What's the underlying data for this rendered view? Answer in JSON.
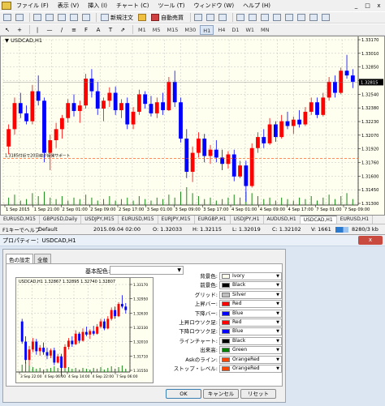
{
  "menubar": {
    "items": [
      "ファイル (F)",
      "表示 (V)",
      "挿入 (I)",
      "チャート (C)",
      "ツール (T)",
      "ウィンドウ (W)",
      "ヘルプ (H)"
    ],
    "window_buttons": [
      "_",
      "□",
      "x"
    ]
  },
  "toolbar1": {
    "new_order": "新規注文",
    "auto_trading": "自動売買"
  },
  "toolbar2": {
    "timeframes": [
      "M1",
      "M5",
      "M15",
      "M30",
      "H1",
      "H4",
      "D1",
      "W1",
      "MN"
    ],
    "active_timeframe": "H1"
  },
  "chart": {
    "title": "USDCAD,H1",
    "annotation": "1.3185付近で20日線が反発サポート",
    "price_labels": [
      "1.33170",
      "1.33010",
      "1.32850",
      "1.32700",
      "1.32540",
      "1.32380",
      "1.32230",
      "1.32070",
      "1.31920",
      "1.31760",
      "1.31600",
      "1.31450",
      "1.31300"
    ],
    "current_price": "1.32815",
    "time_labels": [
      "1 Sep 2015",
      "1 Sep 21:00",
      "2 Sep 01:00",
      "2 Sep 09:00",
      "2 Sep 17:00",
      "3 Sep 01:00",
      "3 Sep 09:00",
      "3 Sep 17:00",
      "4 Sep 01:00",
      "4 Sep 09:00",
      "4 Sep 17:00",
      "7 Sep 01:00",
      "7 Sep 09:00"
    ],
    "tabs": [
      "EURUSD,M15",
      "GBPUSD,Daily",
      "USDJPY,M15",
      "EURUSD,M15",
      "EURJPY,M15",
      "EURGBP,H1",
      "USDJPY,H1",
      "AUDUSD,H1",
      "USDCAD,H1",
      "EURUSD,H1"
    ],
    "active_tab": "USDCAD,H1"
  },
  "chart_data": {
    "type": "candlestick",
    "title": "USDCAD,H1",
    "ylim": [
      1.313,
      1.3325
    ],
    "candles": [
      [
        1.32,
        1.3228,
        1.319,
        1.3222
      ],
      [
        1.3222,
        1.3262,
        1.3215,
        1.3255
      ],
      [
        1.3255,
        1.3268,
        1.3236,
        1.3242
      ],
      [
        1.3242,
        1.3252,
        1.3228,
        1.3232
      ],
      [
        1.3232,
        1.3278,
        1.3228,
        1.327
      ],
      [
        1.327,
        1.329,
        1.3252,
        1.3258
      ],
      [
        1.3258,
        1.3262,
        1.318,
        1.3192
      ],
      [
        1.3192,
        1.3215,
        1.317,
        1.3208
      ],
      [
        1.3208,
        1.323,
        1.3198,
        1.3222
      ],
      [
        1.3222,
        1.324,
        1.321,
        1.3236
      ],
      [
        1.3236,
        1.326,
        1.323,
        1.3255
      ],
      [
        1.3255,
        1.3266,
        1.3238,
        1.3245
      ],
      [
        1.3245,
        1.3258,
        1.323,
        1.3252
      ],
      [
        1.3252,
        1.3292,
        1.3248,
        1.3286
      ],
      [
        1.3286,
        1.3298,
        1.3262,
        1.327
      ],
      [
        1.327,
        1.3282,
        1.324,
        1.3248
      ],
      [
        1.3248,
        1.3262,
        1.3232,
        1.3258
      ],
      [
        1.3258,
        1.3275,
        1.325,
        1.3268
      ],
      [
        1.3268,
        1.3276,
        1.324,
        1.3246
      ],
      [
        1.3246,
        1.326,
        1.3236,
        1.3255
      ],
      [
        1.3255,
        1.3262,
        1.3222,
        1.3228
      ],
      [
        1.3228,
        1.325,
        1.3222,
        1.3244
      ],
      [
        1.3244,
        1.3272,
        1.324,
        1.3266
      ],
      [
        1.3266,
        1.327,
        1.3248,
        1.3254
      ],
      [
        1.3254,
        1.3264,
        1.3238,
        1.3242
      ],
      [
        1.3242,
        1.3262,
        1.3236,
        1.3256
      ],
      [
        1.3256,
        1.3268,
        1.324,
        1.3246
      ],
      [
        1.3246,
        1.3288,
        1.3245,
        1.3282
      ],
      [
        1.3282,
        1.3296,
        1.325,
        1.3256
      ],
      [
        1.3256,
        1.3262,
        1.3205,
        1.321
      ],
      [
        1.321,
        1.3222,
        1.316,
        1.3168
      ],
      [
        1.3168,
        1.32,
        1.3155,
        1.3192
      ],
      [
        1.3192,
        1.3218,
        1.3186,
        1.321
      ],
      [
        1.321,
        1.3216,
        1.318,
        1.3188
      ],
      [
        1.3188,
        1.3202,
        1.3178,
        1.3196
      ],
      [
        1.3196,
        1.3208,
        1.318,
        1.3186
      ],
      [
        1.3186,
        1.3196,
        1.317,
        1.3178
      ],
      [
        1.3178,
        1.3194,
        1.3172,
        1.319
      ],
      [
        1.319,
        1.3196,
        1.3156,
        1.3162
      ],
      [
        1.3162,
        1.3182,
        1.316,
        1.3176
      ],
      [
        1.3176,
        1.3182,
        1.313,
        1.315
      ],
      [
        1.315,
        1.3204,
        1.3148,
        1.3198
      ],
      [
        1.3198,
        1.3218,
        1.3192,
        1.3212
      ],
      [
        1.3212,
        1.3222,
        1.3198,
        1.3204
      ],
      [
        1.3204,
        1.3236,
        1.3202,
        1.3228
      ],
      [
        1.3228,
        1.3232,
        1.3206,
        1.3212
      ],
      [
        1.3212,
        1.324,
        1.321,
        1.3232
      ],
      [
        1.3232,
        1.3244,
        1.3222,
        1.3226
      ],
      [
        1.3226,
        1.3238,
        1.3216,
        1.3234
      ],
      [
        1.3234,
        1.3246,
        1.3224,
        1.3228
      ],
      [
        1.3228,
        1.325,
        1.3226,
        1.3244
      ],
      [
        1.3244,
        1.3262,
        1.324,
        1.3256
      ],
      [
        1.3256,
        1.3262,
        1.3236,
        1.324
      ],
      [
        1.324,
        1.3268,
        1.3238,
        1.3262
      ],
      [
        1.3262,
        1.3288,
        1.3258,
        1.3282
      ],
      [
        1.3282,
        1.329,
        1.3262,
        1.3268
      ],
      [
        1.3268,
        1.33,
        1.3266,
        1.3296
      ],
      [
        1.3296,
        1.3316,
        1.3286,
        1.329
      ],
      [
        1.329,
        1.3298,
        1.3274,
        1.3282
      ]
    ],
    "volumes": [
      5,
      7,
      3,
      4,
      8,
      6,
      9,
      5,
      4,
      6,
      3,
      5,
      4,
      7,
      5,
      3,
      4,
      6,
      3,
      4,
      5,
      3,
      6,
      4,
      3,
      5,
      4,
      7,
      5,
      9,
      12,
      8,
      6,
      4,
      5,
      3,
      4,
      5,
      7,
      5,
      9,
      8,
      6,
      4,
      5,
      3,
      5,
      4,
      3,
      5,
      4,
      6,
      3,
      5,
      7,
      4,
      6,
      8,
      4
    ],
    "current_price": "1.32815"
  },
  "status": {
    "help": "F1キーでヘルプ",
    "profile": "Default",
    "datetime": "2015.09.04 02:00",
    "open": "O: 1.32033",
    "high": "H: 1.32115",
    "low": "L: 1.32019",
    "close": "C: 1.32102",
    "volume": "V: 1661",
    "traffic": "8280/3 kb"
  },
  "dialog": {
    "title": "プロパティー：USDCAD,H1",
    "close": "x",
    "tabs": [
      "色の設定",
      "全般"
    ],
    "scheme_label": "基本配色:",
    "scheme_value": "",
    "preview": {
      "title": "USDCAD,H1",
      "ohlc": "1.32867 1.32895 1.32740 1.32807",
      "price_labels": [
        "1.33170",
        "1.32950",
        "1.32630",
        "1.32330",
        "1.32010",
        "1.31710",
        "1.31550"
      ],
      "time_labels": [
        "3 Sep 22:00",
        "4 Sep 06:00",
        "4 Sep 14:00",
        "4 Sep 22:00",
        "7 Sep 06:00"
      ]
    },
    "properties": [
      {
        "label": "背景色:",
        "value": "Ivory",
        "color": "#fffff0"
      },
      {
        "label": "前景色:",
        "value": "Black",
        "color": "#000000"
      },
      {
        "label": "グリッド:",
        "value": "Silver",
        "color": "#c0c0c0"
      },
      {
        "label": "上昇バー:",
        "value": "Red",
        "color": "#ff0000"
      },
      {
        "label": "下降バー:",
        "value": "Blue",
        "color": "#0000ff"
      },
      {
        "label": "上昇ロウソク足:",
        "value": "Red",
        "color": "#ff0000"
      },
      {
        "label": "下降ロウソク足:",
        "value": "Blue",
        "color": "#0000ff"
      },
      {
        "label": "ラインチャート:",
        "value": "Black",
        "color": "#000000"
      },
      {
        "label": "出来高:",
        "value": "Green",
        "color": "#008000"
      },
      {
        "label": "Askのライン:",
        "value": "OrangeRed",
        "color": "#ff4500"
      },
      {
        "label": "ストップ・レベル:",
        "value": "OrangeRed",
        "color": "#ff4500"
      }
    ],
    "buttons": {
      "ok": "OK",
      "cancel": "キャンセル",
      "reset": "リセット"
    }
  }
}
